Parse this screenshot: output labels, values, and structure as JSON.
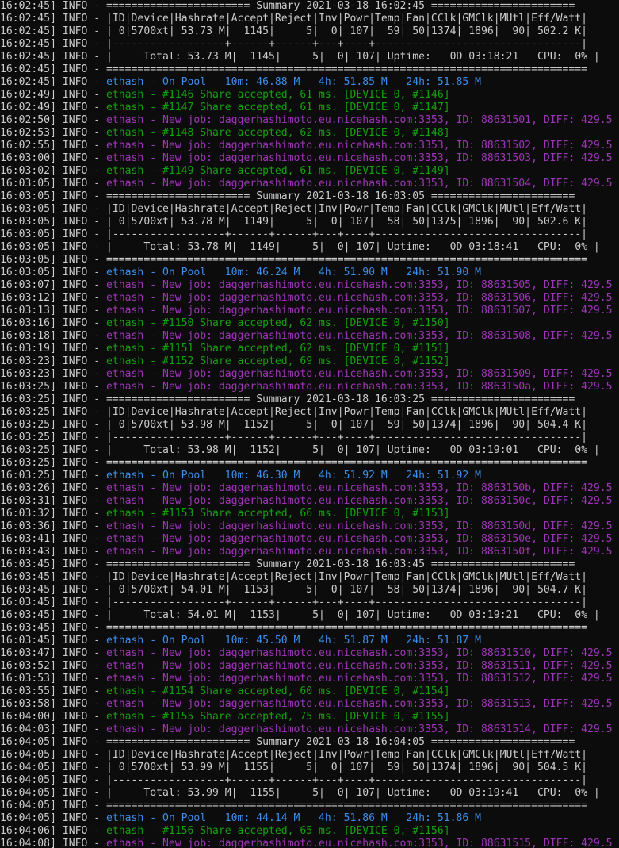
{
  "colors": {
    "default": "#cccccc",
    "pool": "#3b8eea",
    "accept": "#13a10e",
    "job": "#9f36b8",
    "background": "#0c0c0c"
  },
  "lines": [
    {
      "prefix": "16:02:45] INFO - ",
      "message": "======================= Summary 2021-03-18 16:02:45 =======================",
      "kind": "default"
    },
    {
      "prefix": "16:02:45] INFO - ",
      "message": "|ID|Device|Hashrate|Accept|Reject|Inv|Powr|Temp|Fan|CClk|GMClk|MUtl|Eff/Watt|",
      "kind": "default"
    },
    {
      "prefix": "16:02:45] INFO - ",
      "message": "| 0|5700xt| 53.73 M|  1145|     5|  0| 107|  59| 50|1374| 1896|  90| 502.2 K|",
      "kind": "default"
    },
    {
      "prefix": "16:02:45] INFO - ",
      "message": "|------------------+------+------+---+----+---------------------------------|",
      "kind": "default"
    },
    {
      "prefix": "16:02:45] INFO - ",
      "message": "|     Total: 53.73 M|  1145|     5|  0| 107| Uptime:   0D 03:18:21   CPU:  0% |",
      "kind": "default"
    },
    {
      "prefix": "16:02:45] INFO - ",
      "message": "=============================================================================",
      "kind": "default"
    },
    {
      "prefix": "16:02:45] INFO - ",
      "message": "ethash - On Pool   10m: 46.88 M   4h: 51.85 M   24h: 51.85 M",
      "kind": "pool"
    },
    {
      "prefix": "16:02:49] INFO - ",
      "message": "ethash - #1146 Share accepted, 61 ms. [DEVICE 0, #1146]",
      "kind": "accept"
    },
    {
      "prefix": "16:02:49] INFO - ",
      "message": "ethash - #1147 Share accepted, 61 ms. [DEVICE 0, #1147]",
      "kind": "accept"
    },
    {
      "prefix": "16:02:50] INFO - ",
      "message": "ethash - New job: daggerhashimoto.eu.nicehash.com:3353, ID: 88631501, DIFF: 429.5",
      "kind": "job"
    },
    {
      "prefix": "16:02:53] INFO - ",
      "message": "ethash - #1148 Share accepted, 62 ms. [DEVICE 0, #1148]",
      "kind": "accept"
    },
    {
      "prefix": "16:02:55] INFO - ",
      "message": "ethash - New job: daggerhashimoto.eu.nicehash.com:3353, ID: 88631502, DIFF: 429.5",
      "kind": "job"
    },
    {
      "prefix": "16:03:00] INFO - ",
      "message": "ethash - New job: daggerhashimoto.eu.nicehash.com:3353, ID: 88631503, DIFF: 429.5",
      "kind": "job"
    },
    {
      "prefix": "16:03:02] INFO - ",
      "message": "ethash - #1149 Share accepted, 61 ms. [DEVICE 0, #1149]",
      "kind": "accept"
    },
    {
      "prefix": "16:03:05] INFO - ",
      "message": "ethash - New job: daggerhashimoto.eu.nicehash.com:3353, ID: 88631504, DIFF: 429.5",
      "kind": "job"
    },
    {
      "prefix": "16:03:05] INFO - ",
      "message": "======================= Summary 2021-03-18 16:03:05 =======================",
      "kind": "default"
    },
    {
      "prefix": "16:03:05] INFO - ",
      "message": "|ID|Device|Hashrate|Accept|Reject|Inv|Powr|Temp|Fan|CClk|GMClk|MUtl|Eff/Watt|",
      "kind": "default"
    },
    {
      "prefix": "16:03:05] INFO - ",
      "message": "| 0|5700xt| 53.78 M|  1149|     5|  0| 107|  58| 50|1375| 1896|  90| 502.6 K|",
      "kind": "default"
    },
    {
      "prefix": "16:03:05] INFO - ",
      "message": "|------------------+------+------+---+----+---------------------------------|",
      "kind": "default"
    },
    {
      "prefix": "16:03:05] INFO - ",
      "message": "|     Total: 53.78 M|  1149|     5|  0| 107| Uptime:   0D 03:18:41   CPU:  0% |",
      "kind": "default"
    },
    {
      "prefix": "16:03:05] INFO - ",
      "message": "=============================================================================",
      "kind": "default"
    },
    {
      "prefix": "16:03:05] INFO - ",
      "message": "ethash - On Pool   10m: 46.24 M   4h: 51.90 M   24h: 51.90 M",
      "kind": "pool"
    },
    {
      "prefix": "16:03:07] INFO - ",
      "message": "ethash - New job: daggerhashimoto.eu.nicehash.com:3353, ID: 88631505, DIFF: 429.5",
      "kind": "job"
    },
    {
      "prefix": "16:03:12] INFO - ",
      "message": "ethash - New job: daggerhashimoto.eu.nicehash.com:3353, ID: 88631506, DIFF: 429.5",
      "kind": "job"
    },
    {
      "prefix": "16:03:13] INFO - ",
      "message": "ethash - New job: daggerhashimoto.eu.nicehash.com:3353, ID: 88631507, DIFF: 429.5",
      "kind": "job"
    },
    {
      "prefix": "16:03:16] INFO - ",
      "message": "ethash - #1150 Share accepted, 62 ms. [DEVICE 0, #1150]",
      "kind": "accept"
    },
    {
      "prefix": "16:03:18] INFO - ",
      "message": "ethash - New job: daggerhashimoto.eu.nicehash.com:3353, ID: 88631508, DIFF: 429.5",
      "kind": "job"
    },
    {
      "prefix": "16:03:19] INFO - ",
      "message": "ethash - #1151 Share accepted, 62 ms. [DEVICE 0, #1151]",
      "kind": "accept"
    },
    {
      "prefix": "16:03:23] INFO - ",
      "message": "ethash - #1152 Share accepted, 69 ms. [DEVICE 0, #1152]",
      "kind": "accept"
    },
    {
      "prefix": "16:03:23] INFO - ",
      "message": "ethash - New job: daggerhashimoto.eu.nicehash.com:3353, ID: 88631509, DIFF: 429.5",
      "kind": "job"
    },
    {
      "prefix": "16:03:25] INFO - ",
      "message": "ethash - New job: daggerhashimoto.eu.nicehash.com:3353, ID: 8863150a, DIFF: 429.5",
      "kind": "job"
    },
    {
      "prefix": "16:03:25] INFO - ",
      "message": "======================= Summary 2021-03-18 16:03:25 =======================",
      "kind": "default"
    },
    {
      "prefix": "16:03:25] INFO - ",
      "message": "|ID|Device|Hashrate|Accept|Reject|Inv|Powr|Temp|Fan|CClk|GMClk|MUtl|Eff/Watt|",
      "kind": "default"
    },
    {
      "prefix": "16:03:25] INFO - ",
      "message": "| 0|5700xt| 53.98 M|  1152|     5|  0| 107|  59| 50|1374| 1896|  90| 504.4 K|",
      "kind": "default"
    },
    {
      "prefix": "16:03:25] INFO - ",
      "message": "|------------------+------+------+---+----+---------------------------------|",
      "kind": "default"
    },
    {
      "prefix": "16:03:25] INFO - ",
      "message": "|     Total: 53.98 M|  1152|     5|  0| 107| Uptime:   0D 03:19:01   CPU:  0% |",
      "kind": "default"
    },
    {
      "prefix": "16:03:25] INFO - ",
      "message": "=============================================================================",
      "kind": "default"
    },
    {
      "prefix": "16:03:25] INFO - ",
      "message": "ethash - On Pool   10m: 46.30 M   4h: 51.92 M   24h: 51.92 M",
      "kind": "pool"
    },
    {
      "prefix": "16:03:26] INFO - ",
      "message": "ethash - New job: daggerhashimoto.eu.nicehash.com:3353, ID: 8863150b, DIFF: 429.5",
      "kind": "job"
    },
    {
      "prefix": "16:03:31] INFO - ",
      "message": "ethash - New job: daggerhashimoto.eu.nicehash.com:3353, ID: 8863150c, DIFF: 429.5",
      "kind": "job"
    },
    {
      "prefix": "16:03:32] INFO - ",
      "message": "ethash - #1153 Share accepted, 66 ms. [DEVICE 0, #1153]",
      "kind": "accept"
    },
    {
      "prefix": "16:03:36] INFO - ",
      "message": "ethash - New job: daggerhashimoto.eu.nicehash.com:3353, ID: 8863150d, DIFF: 429.5",
      "kind": "job"
    },
    {
      "prefix": "16:03:41] INFO - ",
      "message": "ethash - New job: daggerhashimoto.eu.nicehash.com:3353, ID: 8863150e, DIFF: 429.5",
      "kind": "job"
    },
    {
      "prefix": "16:03:43] INFO - ",
      "message": "ethash - New job: daggerhashimoto.eu.nicehash.com:3353, ID: 8863150f, DIFF: 429.5",
      "kind": "job"
    },
    {
      "prefix": "16:03:45] INFO - ",
      "message": "======================= Summary 2021-03-18 16:03:45 =======================",
      "kind": "default"
    },
    {
      "prefix": "16:03:45] INFO - ",
      "message": "|ID|Device|Hashrate|Accept|Reject|Inv|Powr|Temp|Fan|CClk|GMClk|MUtl|Eff/Watt|",
      "kind": "default"
    },
    {
      "prefix": "16:03:45] INFO - ",
      "message": "| 0|5700xt| 54.01 M|  1153|     5|  0| 107|  58| 50|1374| 1896|  90| 504.7 K|",
      "kind": "default"
    },
    {
      "prefix": "16:03:45] INFO - ",
      "message": "|------------------+------+------+---+----+---------------------------------|",
      "kind": "default"
    },
    {
      "prefix": "16:03:45] INFO - ",
      "message": "|     Total: 54.01 M|  1153|     5|  0| 107| Uptime:   0D 03:19:21   CPU:  0% |",
      "kind": "default"
    },
    {
      "prefix": "16:03:45] INFO - ",
      "message": "=============================================================================",
      "kind": "default"
    },
    {
      "prefix": "16:03:45] INFO - ",
      "message": "ethash - On Pool   10m: 45.50 M   4h: 51.87 M   24h: 51.87 M",
      "kind": "pool"
    },
    {
      "prefix": "16:03:47] INFO - ",
      "message": "ethash - New job: daggerhashimoto.eu.nicehash.com:3353, ID: 88631510, DIFF: 429.5",
      "kind": "job"
    },
    {
      "prefix": "16:03:52] INFO - ",
      "message": "ethash - New job: daggerhashimoto.eu.nicehash.com:3353, ID: 88631511, DIFF: 429.5",
      "kind": "job"
    },
    {
      "prefix": "16:03:53] INFO - ",
      "message": "ethash - New job: daggerhashimoto.eu.nicehash.com:3353, ID: 88631512, DIFF: 429.5",
      "kind": "job"
    },
    {
      "prefix": "16:03:55] INFO - ",
      "message": "ethash - #1154 Share accepted, 60 ms. [DEVICE 0, #1154]",
      "kind": "accept"
    },
    {
      "prefix": "16:03:58] INFO - ",
      "message": "ethash - New job: daggerhashimoto.eu.nicehash.com:3353, ID: 88631513, DIFF: 429.5",
      "kind": "job"
    },
    {
      "prefix": "16:04:00] INFO - ",
      "message": "ethash - #1155 Share accepted, 75 ms. [DEVICE 0, #1155]",
      "kind": "accept"
    },
    {
      "prefix": "16:04:03] INFO - ",
      "message": "ethash - New job: daggerhashimoto.eu.nicehash.com:3353, ID: 88631514, DIFF: 429.5",
      "kind": "job"
    },
    {
      "prefix": "16:04:05] INFO - ",
      "message": "======================= Summary 2021-03-18 16:04:05 =======================",
      "kind": "default"
    },
    {
      "prefix": "16:04:05] INFO - ",
      "message": "|ID|Device|Hashrate|Accept|Reject|Inv|Powr|Temp|Fan|CClk|GMClk|MUtl|Eff/Watt|",
      "kind": "default"
    },
    {
      "prefix": "16:04:05] INFO - ",
      "message": "| 0|5700xt| 53.99 M|  1155|     5|  0| 107|  59| 50|1374| 1896|  90| 504.5 K|",
      "kind": "default"
    },
    {
      "prefix": "16:04:05] INFO - ",
      "message": "|------------------+------+------+---+----+---------------------------------|",
      "kind": "default"
    },
    {
      "prefix": "16:04:05] INFO - ",
      "message": "|     Total: 53.99 M|  1155|     5|  0| 107| Uptime:   0D 03:19:41   CPU:  0% |",
      "kind": "default"
    },
    {
      "prefix": "16:04:05] INFO - ",
      "message": "=============================================================================",
      "kind": "default"
    },
    {
      "prefix": "16:04:05] INFO - ",
      "message": "ethash - On Pool   10m: 44.14 M   4h: 51.86 M   24h: 51.86 M",
      "kind": "pool"
    },
    {
      "prefix": "16:04:06] INFO - ",
      "message": "ethash - #1156 Share accepted, 65 ms. [DEVICE 0, #1156]",
      "kind": "accept"
    },
    {
      "prefix": "16:04:08] INFO - ",
      "message": "ethash - New job: daggerhashimoto.eu.nicehash.com:3353, ID: 88631515, DIFF: 429.5",
      "kind": "job"
    }
  ]
}
